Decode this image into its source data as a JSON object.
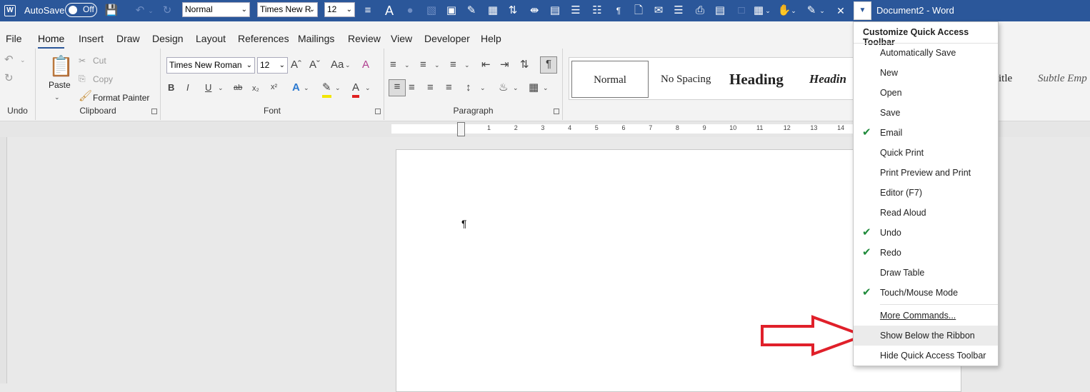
{
  "titlebar": {
    "autosave_label": "AutoSave",
    "autosave_state": "Off",
    "style_combo": "Normal",
    "font_combo": "Times New R",
    "size_combo": "12",
    "doc_title": "Document2  -  Word"
  },
  "menu": {
    "tabs": [
      "File",
      "Home",
      "Insert",
      "Draw",
      "Design",
      "Layout",
      "References",
      "Mailings",
      "Review",
      "View",
      "Developer",
      "Help"
    ],
    "active": "Home"
  },
  "ribbon": {
    "undo_group": "Undo",
    "clipboard": {
      "paste": "Paste",
      "cut": "Cut",
      "copy": "Copy",
      "format_painter": "Format Painter",
      "label": "Clipboard"
    },
    "font": {
      "name": "Times New Roman",
      "size": "12",
      "label": "Font"
    },
    "paragraph": {
      "label": "Paragraph"
    },
    "styles": [
      "Normal",
      "No Spacing",
      "Heading",
      "Headin",
      "itle",
      "Subtle Emp"
    ]
  },
  "ruler": {
    "numbers": [
      "1",
      "2",
      "3",
      "4",
      "5",
      "6",
      "7",
      "8",
      "9",
      "10",
      "11",
      "12",
      "13",
      "14"
    ]
  },
  "dropdown": {
    "title": "Customize Quick Access Toolbar",
    "items": [
      {
        "label": "Automatically Save",
        "checked": false
      },
      {
        "label": "New",
        "checked": false
      },
      {
        "label": "Open",
        "checked": false
      },
      {
        "label": "Save",
        "checked": false
      },
      {
        "label": "Email",
        "checked": true
      },
      {
        "label": "Quick Print",
        "checked": false
      },
      {
        "label": "Print Preview and Print",
        "checked": false
      },
      {
        "label": "Editor (F7)",
        "checked": false
      },
      {
        "label": "Read Aloud",
        "checked": false
      },
      {
        "label": "Undo",
        "checked": true
      },
      {
        "label": "Redo",
        "checked": true
      },
      {
        "label": "Draw Table",
        "checked": false
      },
      {
        "label": "Touch/Mouse Mode",
        "checked": true
      }
    ],
    "more_commands": "More Commands...",
    "show_below": "Show Below the Ribbon",
    "hide_toolbar": "Hide Quick Access Toolbar",
    "highlighted": "Show Below the Ribbon"
  },
  "colors": {
    "title_bar": "#2b579a",
    "check": "#1f8a3b",
    "annotation_arrow": "#e0202a"
  }
}
